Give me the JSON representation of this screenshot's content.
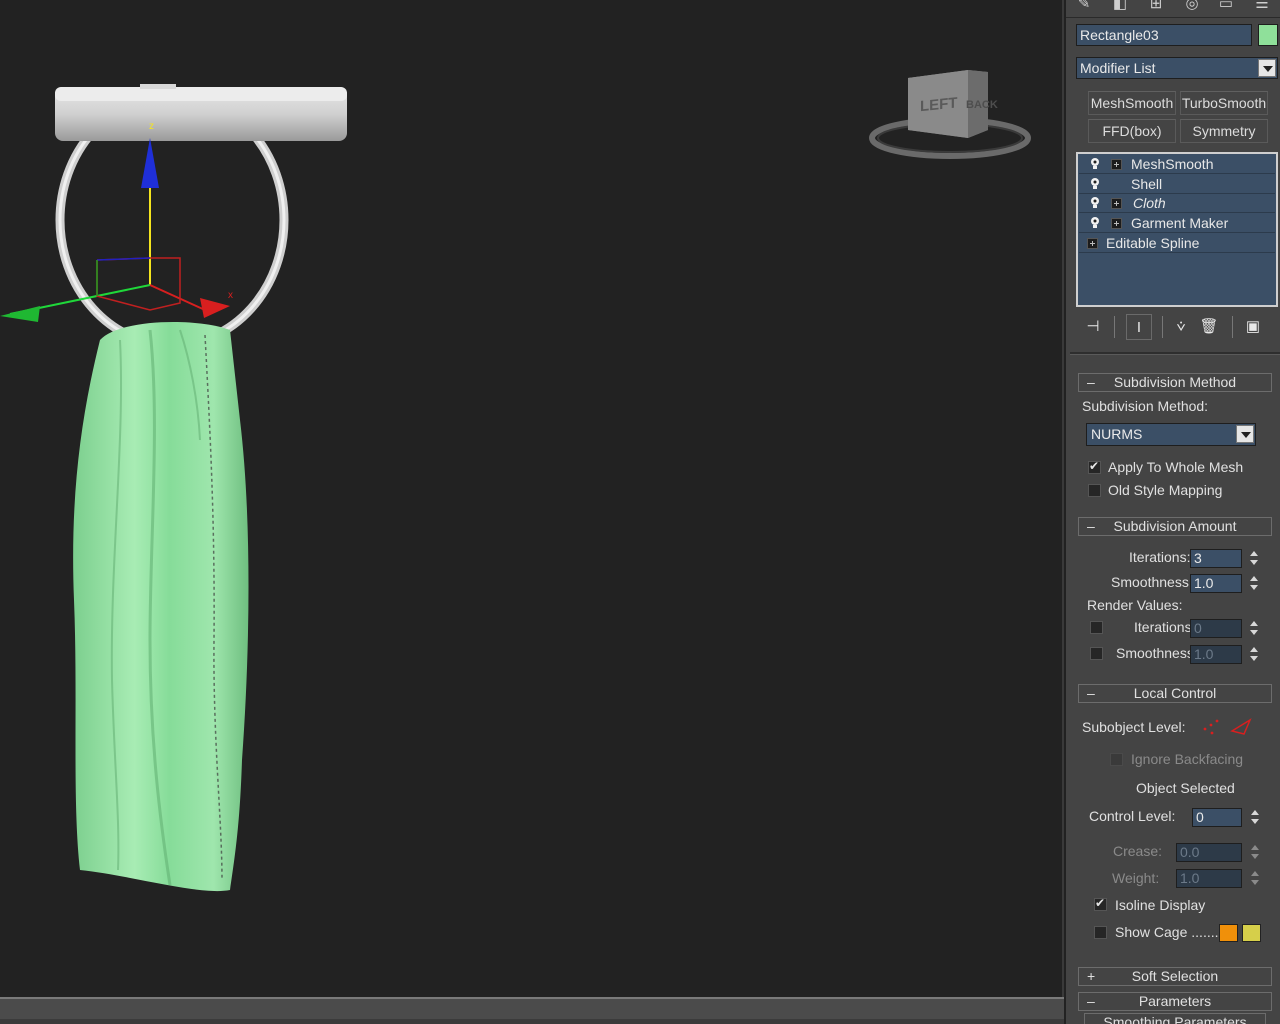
{
  "viewport": {
    "viewcube_left": "LEFT",
    "viewcube_back": "BACK",
    "axis_z": "z",
    "axis_x": "x"
  },
  "panel": {
    "object_name": "Rectangle03",
    "object_color": "#8fe09a",
    "modifier_list": "Modifier List",
    "modifier_sets": [
      "MeshSmooth",
      "TurboSmooth",
      "FFD(box)",
      "Symmetry"
    ],
    "stack": [
      {
        "label": "MeshSmooth",
        "bulb": true,
        "expand": true
      },
      {
        "label": "Shell",
        "bulb": true,
        "expand": false
      },
      {
        "label": "Cloth",
        "bulb": true,
        "expand": true
      },
      {
        "label": "Garment Maker",
        "bulb": true,
        "expand": true
      },
      {
        "label": "Editable Spline",
        "bulb": false,
        "expand": true
      }
    ],
    "rollouts": {
      "subdivision_method": "Subdivision Method",
      "subdivision_amount": "Subdivision Amount",
      "local_control": "Local Control",
      "soft_selection": "Soft Selection",
      "parameters": "Parameters",
      "smoothing_parameters": "Smoothing Parameters"
    },
    "subdivision_method": {
      "label": "Subdivision Method:",
      "value": "NURMS",
      "apply_whole_mesh": "Apply To Whole Mesh",
      "old_style_mapping": "Old Style Mapping"
    },
    "subdivision_amount": {
      "iterations_label": "Iterations:",
      "iterations": "3",
      "smoothness_label": "Smoothness:",
      "smoothness": "1.0",
      "render_values": "Render Values:",
      "render_iterations_label": "Iterations:",
      "render_iterations": "0",
      "render_smoothness_label": "Smoothness:",
      "render_smoothness": "1.0"
    },
    "local_control": {
      "subobject_level": "Subobject Level:",
      "ignore_backfacing": "Ignore Backfacing",
      "object_selected": "Object Selected",
      "control_level_label": "Control Level:",
      "control_level": "0",
      "crease_label": "Crease:",
      "crease": "0.0",
      "weight_label": "Weight:",
      "weight": "1.0",
      "isoline_display": "Isoline Display",
      "show_cage": "Show Cage .......",
      "cage_color_1": "#f0900a",
      "cage_color_2": "#d6cf4a"
    },
    "signs": {
      "minus": "–",
      "plus": "+"
    }
  }
}
